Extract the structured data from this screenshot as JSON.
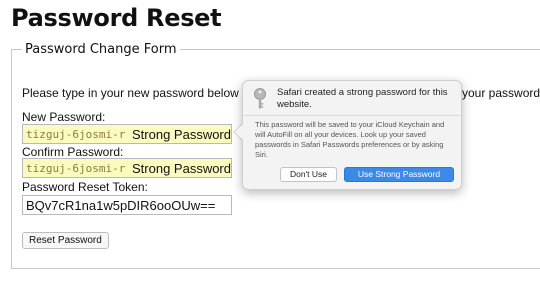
{
  "page": {
    "title": "Password Reset"
  },
  "form": {
    "legend": "Password Change Form",
    "instructions_left": "Please type in your new password below and",
    "instructions_right": "your password.",
    "new_password_label": "New Password:",
    "new_password_value": "tizguj-6josmi-r",
    "new_password_badge": "Strong Password",
    "confirm_password_label": "Confirm Password:",
    "confirm_password_value": "tizguj-6josmi-r",
    "confirm_password_badge": "Strong Password",
    "token_label": "Password Reset Token:",
    "token_value": "BQv7cR1na1w5pDIR6ooOUw==",
    "reset_button": "Reset Password"
  },
  "popup": {
    "icon": "key-icon",
    "title": "Safari created a strong password for this website.",
    "body": "This password will be saved to your iCloud Keychain and will AutoFill on all your devices. Look up your saved passwords in Safari Passwords preferences or by asking Siri.",
    "dont_use_button": "Don't Use",
    "use_strong_button": "Use Strong Password",
    "accent_color": "#3b89e8"
  }
}
